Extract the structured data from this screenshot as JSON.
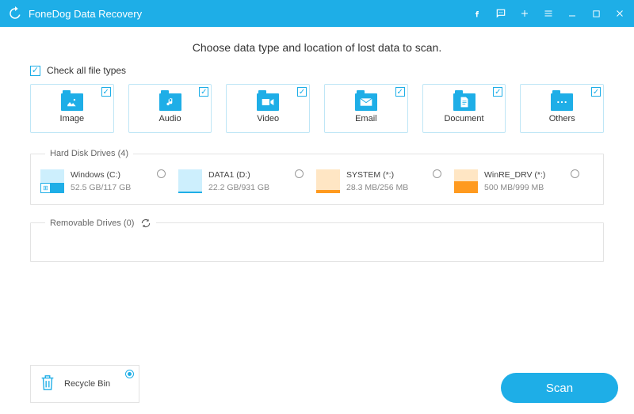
{
  "titlebar": {
    "title": "FoneDog Data Recovery"
  },
  "heading": "Choose data type and location of lost data to scan.",
  "check_all": {
    "label": "Check all file types",
    "checked": true
  },
  "file_types": [
    {
      "key": "image",
      "label": "Image",
      "checked": true
    },
    {
      "key": "audio",
      "label": "Audio",
      "checked": true
    },
    {
      "key": "video",
      "label": "Video",
      "checked": true
    },
    {
      "key": "email",
      "label": "Email",
      "checked": true
    },
    {
      "key": "document",
      "label": "Document",
      "checked": true
    },
    {
      "key": "others",
      "label": "Others",
      "checked": true
    }
  ],
  "hard_drives": {
    "legend": "Hard Disk Drives (4)",
    "items": [
      {
        "name": "Windows (C:)",
        "size": "52.5 GB/117 GB",
        "used_pct": 45,
        "warn": false,
        "system": true,
        "selected": false
      },
      {
        "name": "DATA1 (D:)",
        "size": "22.2 GB/931 GB",
        "used_pct": 3,
        "warn": false,
        "system": false,
        "selected": false
      },
      {
        "name": "SYSTEM (*:)",
        "size": "28.3 MB/256 MB",
        "used_pct": 11,
        "warn": true,
        "system": false,
        "selected": false
      },
      {
        "name": "WinRE_DRV (*:)",
        "size": "500 MB/999 MB",
        "used_pct": 50,
        "warn": true,
        "system": false,
        "selected": false
      }
    ]
  },
  "removable": {
    "legend": "Removable Drives (0)"
  },
  "recycle_bin": {
    "label": "Recycle Bin",
    "selected": true
  },
  "scan_button": "Scan"
}
